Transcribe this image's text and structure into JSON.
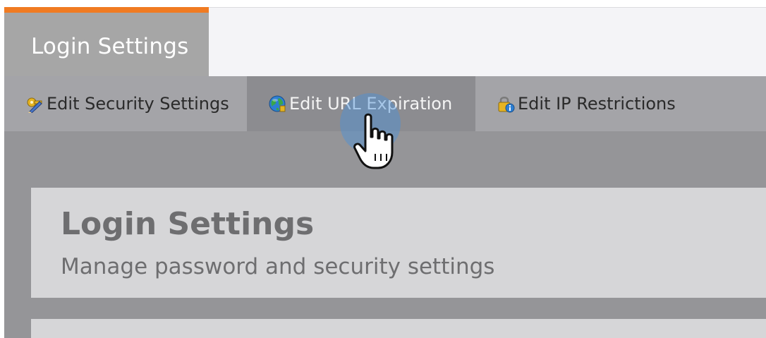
{
  "colors": {
    "accent": "#f07b22",
    "globe_blue": "#2d7fd3",
    "globe_green": "#3aa64a",
    "lock_gold": "#e6b422"
  },
  "header": {
    "title": "Login Settings"
  },
  "subtabs": [
    {
      "label": "Edit Security Settings",
      "icon": "key-pencil-icon"
    },
    {
      "label": "Edit URL Expiration",
      "icon": "globe-icon"
    },
    {
      "label": "Edit IP Restrictions",
      "icon": "lock-info-icon"
    }
  ],
  "panel": {
    "heading": "Login Settings",
    "subheading": "Manage password and security settings"
  },
  "cursor": {
    "icon": "hand-pointer-icon"
  }
}
